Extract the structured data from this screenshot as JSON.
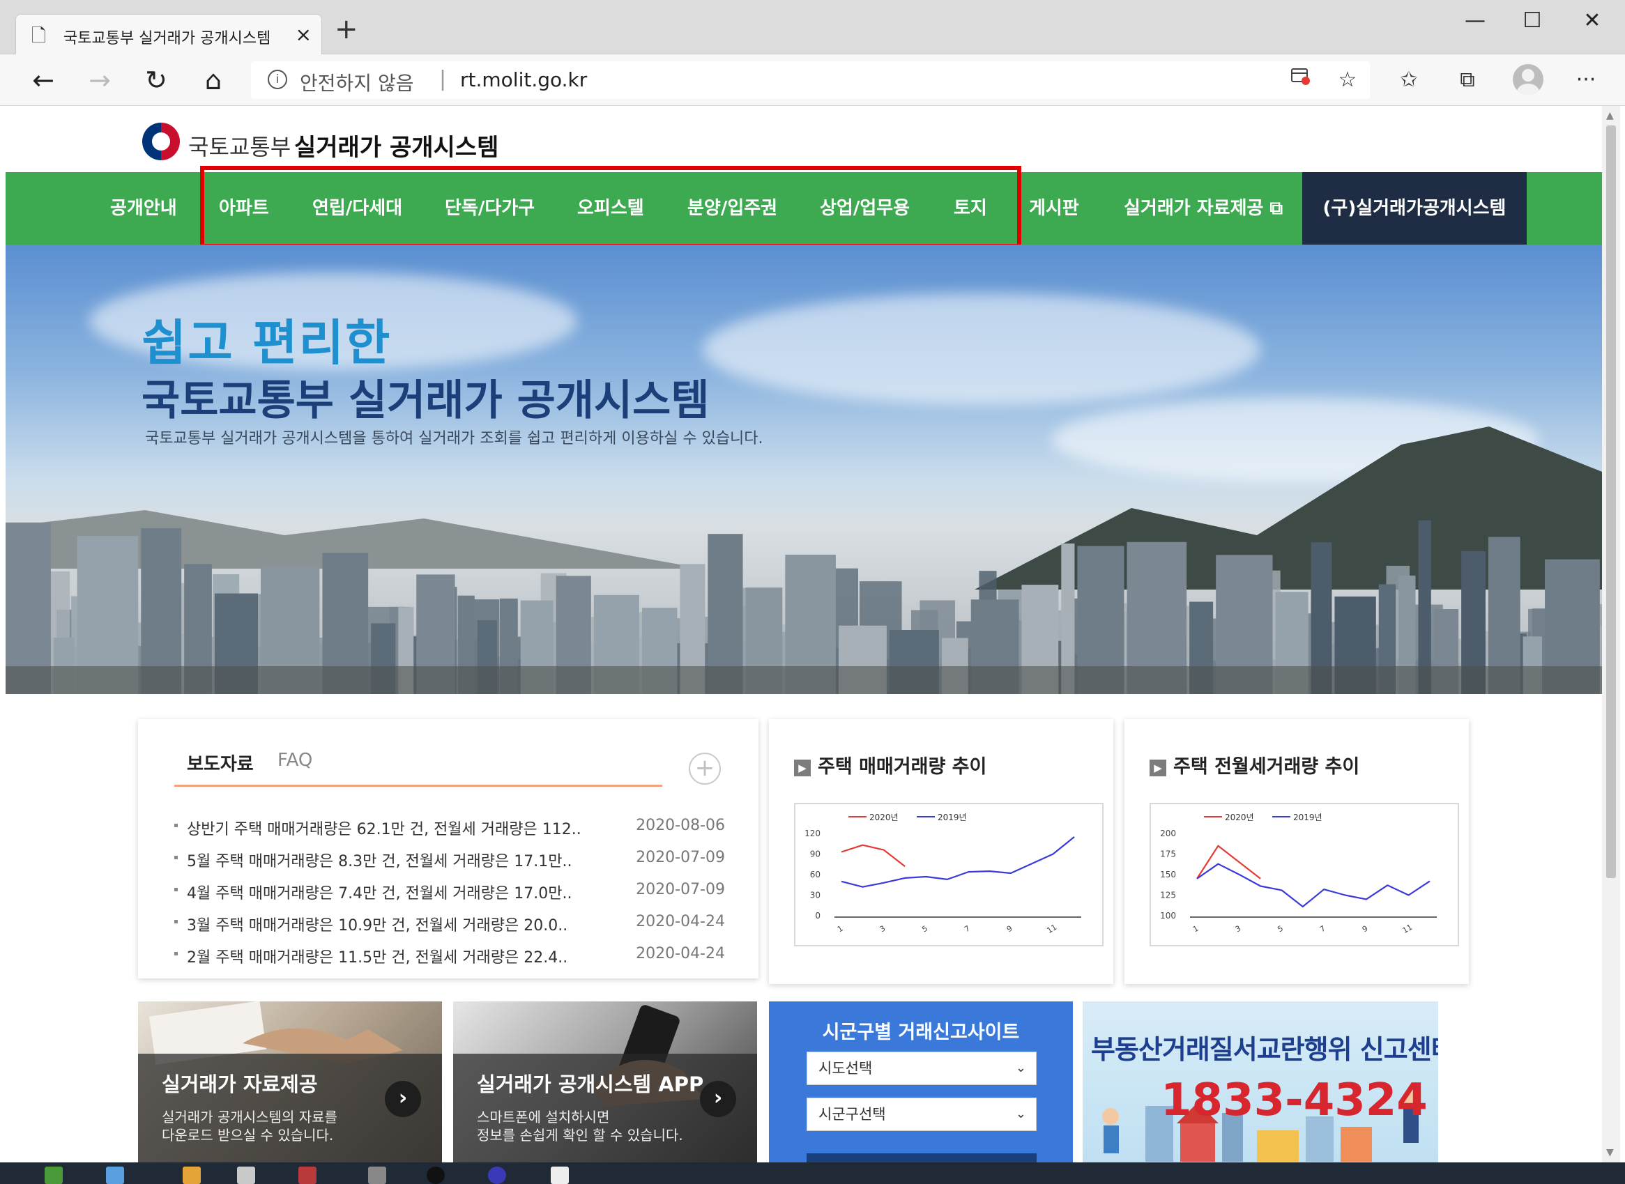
{
  "browser": {
    "tab_title": "국토교통부 실거래가 공개시스템",
    "tab_close": "×",
    "new_tab": "+",
    "security_text": "안전하지 않음",
    "url": "rt.molit.go.kr",
    "window_controls": {
      "minimize": "—",
      "maximize": "☐",
      "close": "✕"
    },
    "nav": {
      "back": "←",
      "forward": "→",
      "refresh": "↻",
      "home": "⌂"
    },
    "toolbar": {
      "favorite": "☆",
      "favorites": "✩",
      "collections": "⧉",
      "more": "···"
    }
  },
  "site": {
    "org_name": "국토교통부",
    "system_name": "실거래가 공개시스템",
    "nav_items": [
      {
        "label": "공개안내"
      },
      {
        "label": "아파트"
      },
      {
        "label": "연립/다세대"
      },
      {
        "label": "단독/다가구"
      },
      {
        "label": "오피스텔"
      },
      {
        "label": "분양/입주권"
      },
      {
        "label": "상업/업무용"
      },
      {
        "label": "토지"
      },
      {
        "label": "게시판"
      },
      {
        "label": "실거래가 자료제공 ⧉"
      }
    ],
    "nav_old_system": "(구)실거래가공개시스템",
    "accent_green": "#3daa52",
    "dark_navy": "#1f2d44"
  },
  "hero": {
    "line1": "쉽고 편리한",
    "line2": "국토교통부 실거래가 공개시스템",
    "subtitle": "국토교통부 실거래가 공개시스템을 통하여 실거래가 조회를 쉽고 편리하게 이용하실 수 있습니다."
  },
  "news": {
    "tab_active": "보도자료",
    "tab_inactive": "FAQ",
    "more": "+",
    "items": [
      {
        "title": "상반기 주택 매매거래량은 62.1만 건, 전월세 거래량은 112..",
        "date": "2020-08-06"
      },
      {
        "title": "5월 주택 매매거래량은 8.3만 건, 전월세 거래량은 17.1만..",
        "date": "2020-07-09"
      },
      {
        "title": "4월 주택 매매거래량은 7.4만 건, 전월세 거래량은 17.0만..",
        "date": "2020-07-09"
      },
      {
        "title": "3월 주택 매매거래량은 10.9만 건, 전월세 거래량은 20.0..",
        "date": "2020-04-24"
      },
      {
        "title": "2월 주택 매매거래량은 11.5만 건, 전월세 거래량은 22.4..",
        "date": "2020-04-24"
      }
    ]
  },
  "charts": {
    "chart1_title": "주택 매매거래량 추이",
    "chart2_title": "주택 전월세거래량 추이",
    "bullet": "▶"
  },
  "chart_data": [
    {
      "type": "line",
      "title": "주택 매매거래량 추이",
      "x": [
        1,
        2,
        3,
        4,
        5,
        6,
        7,
        8,
        9,
        10,
        11,
        12
      ],
      "xticks": [
        "1",
        "3",
        "5",
        "7",
        "9",
        "11"
      ],
      "yticks": [
        "120",
        "90",
        "60",
        "30",
        "0"
      ],
      "ylim": [
        0,
        120
      ],
      "series": [
        {
          "name": "2020년",
          "color": "#e53935",
          "values": [
            93,
            103,
            96,
            72
          ]
        },
        {
          "name": "2019년",
          "color": "#3a3adb",
          "values": [
            50,
            42,
            48,
            55,
            57,
            53,
            64,
            65,
            62,
            76,
            90,
            115
          ]
        }
      ]
    },
    {
      "type": "line",
      "title": "주택 전월세거래량 추이",
      "x": [
        1,
        2,
        3,
        4,
        5,
        6,
        7,
        8,
        9,
        10,
        11,
        12
      ],
      "xticks": [
        "1",
        "3",
        "5",
        "7",
        "9",
        "11"
      ],
      "yticks": [
        "200",
        "175",
        "150",
        "125",
        "100"
      ],
      "ylim": [
        100,
        200
      ],
      "series": [
        {
          "name": "2020년",
          "color": "#e53935",
          "values": [
            145,
            185,
            165,
            145
          ]
        },
        {
          "name": "2019년",
          "color": "#3a3adb",
          "values": [
            145,
            163,
            150,
            136,
            131,
            111,
            132,
            125,
            120,
            137,
            125,
            142
          ]
        }
      ]
    }
  ],
  "banners": {
    "data_title": "실거래가 자료제공",
    "data_sub1": "실거래가 공개시스템의 자료를",
    "data_sub2": "다운로드 받으실 수 있습니다.",
    "app_title": "실거래가 공개시스템 APP",
    "app_sub1": "스마트폰에 설치하시면",
    "app_sub2": "정보를 손쉽게 확인 할 수 있습니다.",
    "arrow": "›",
    "report_title": "시군구별 거래신고사이트",
    "select_sido": "시도선택",
    "select_sigungu": "시군구선택",
    "chevron": "⌄",
    "center_title": "부동산거래질서교란행위 신고센터",
    "center_phone": "1833-4324"
  }
}
